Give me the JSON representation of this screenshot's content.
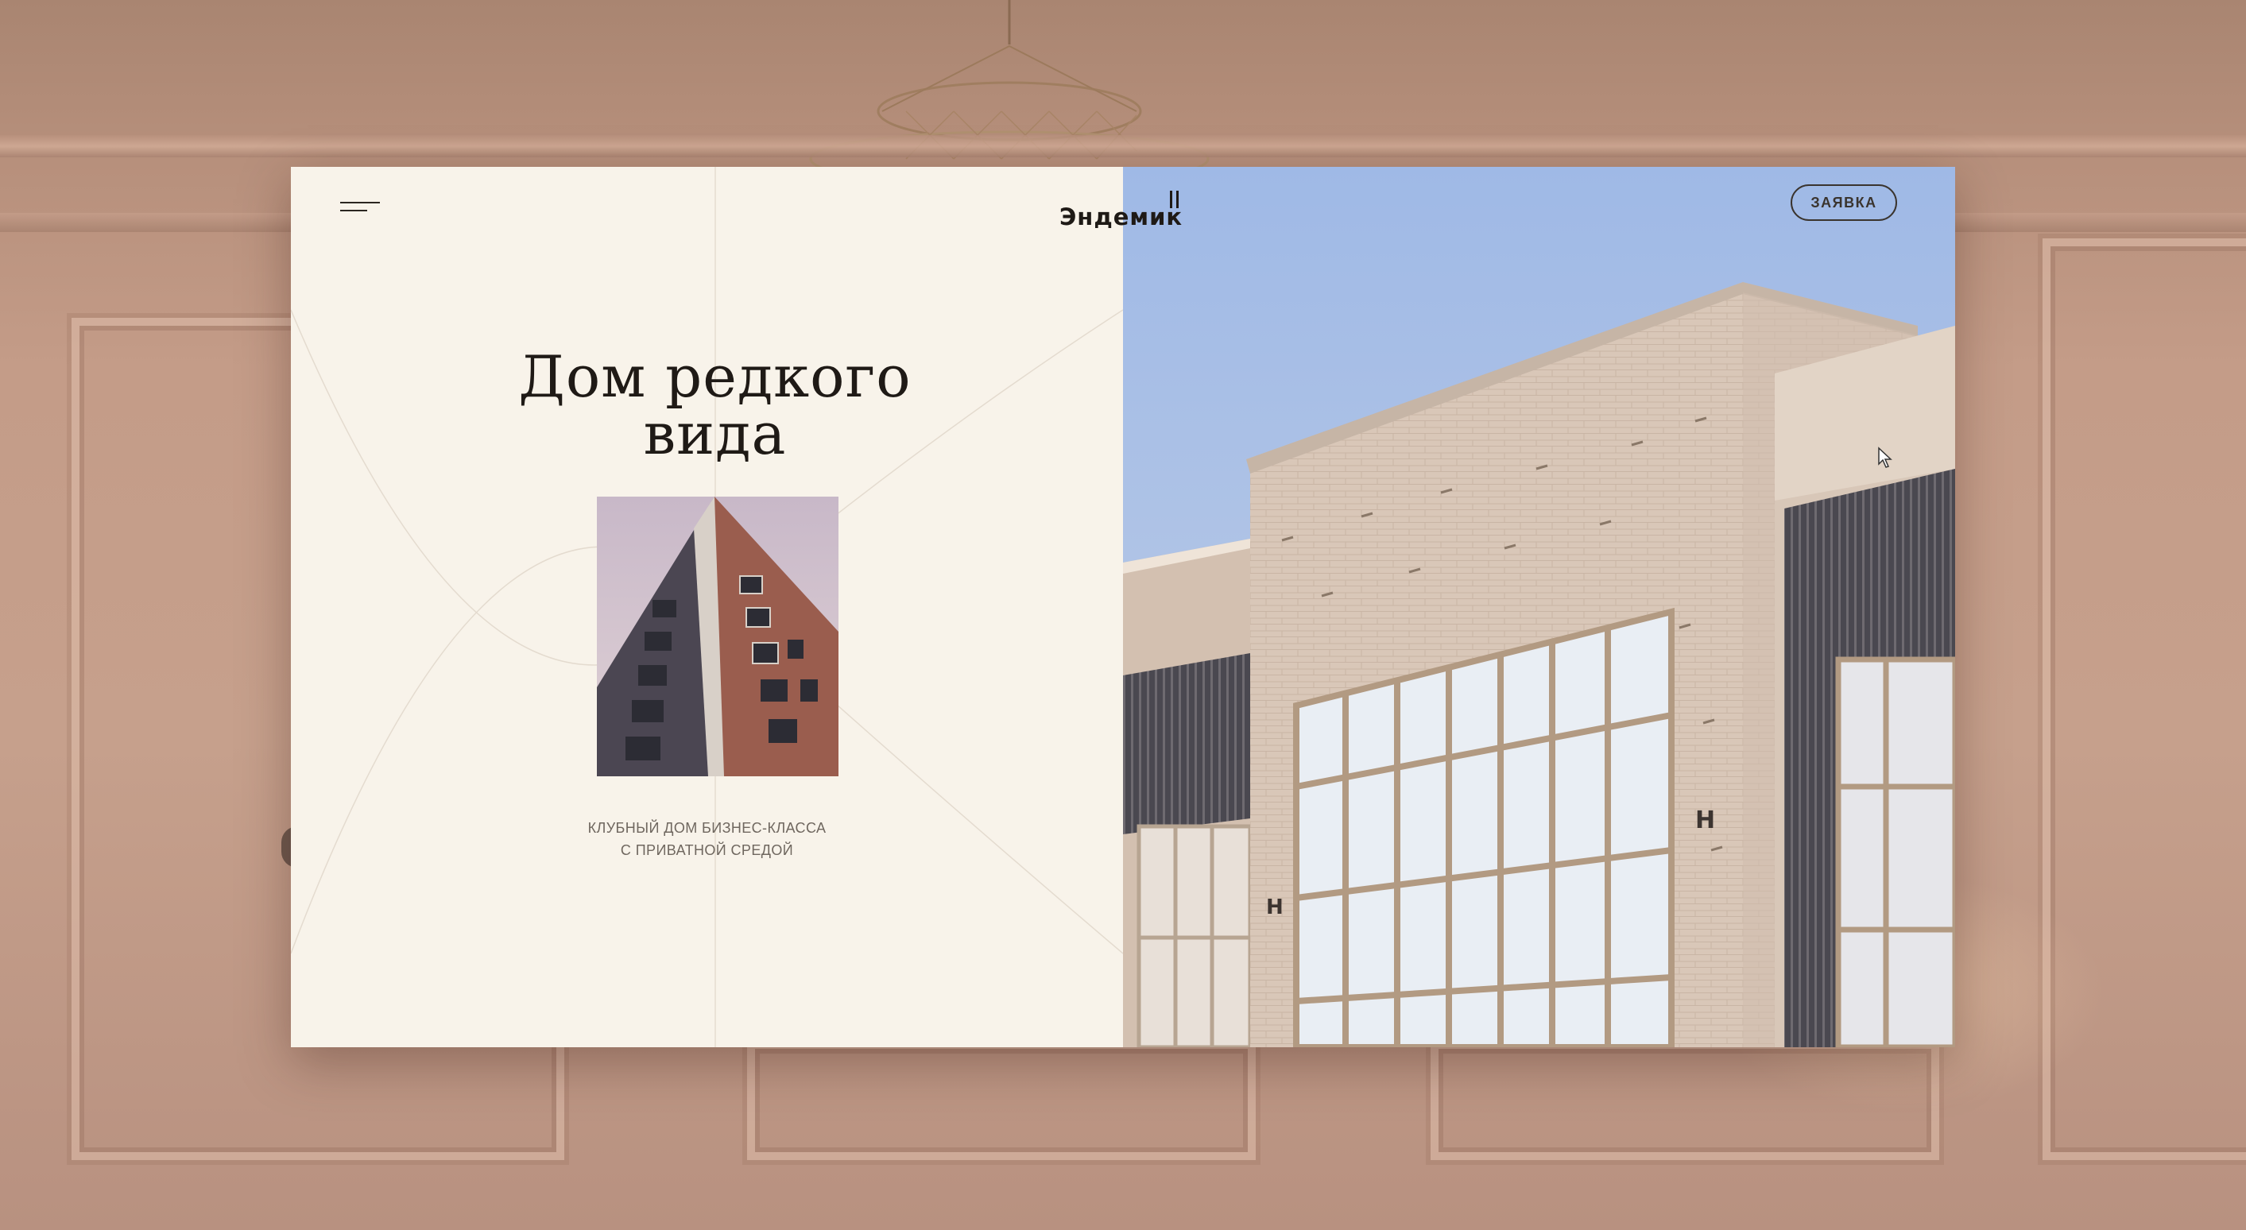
{
  "header": {
    "menu_icon": "hamburger-menu-icon",
    "logo_text": "Эндемик",
    "logo_mark": "II",
    "request_button_label": "ЗАЯВКА"
  },
  "hero": {
    "headline_line1": "Дом редкого",
    "headline_line2": "вида",
    "subtitle_line1": "КЛУБНЫЙ ДОМ БИЗНЕС-КЛАССА",
    "subtitle_line2": "С ПРИВАТНОЙ СРЕДОЙ"
  },
  "colors": {
    "panel_background": "#f8f3ea",
    "text_dark": "#1f1a16",
    "text_muted": "#6f675f",
    "sky": "#a9c0e2",
    "brick": "#d7c6b8"
  }
}
